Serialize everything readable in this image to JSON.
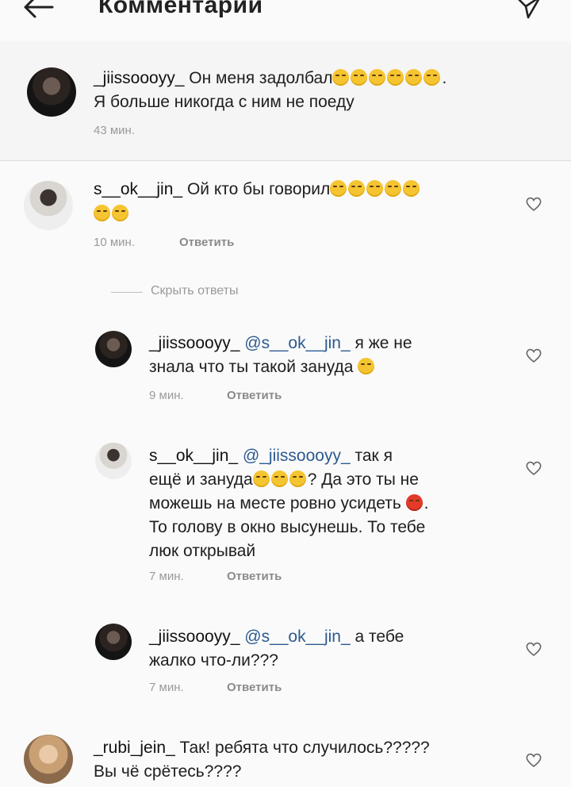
{
  "header": {
    "title": "Комментарии"
  },
  "original_post": {
    "username": "_jiissoooyy_",
    "text_1": "Он меня задолбал",
    "text_1_suffix": ".",
    "text_2": "Я больше никогда с ним не поеду",
    "time": "43 мин."
  },
  "comment_1": {
    "username": "s__ok__jin_",
    "text": "Ой кто бы говорил",
    "time": "10 мин.",
    "reply_label": "Ответить"
  },
  "hide_replies": "Скрыть ответы",
  "reply_1": {
    "username": "_jiissoooyy_",
    "mention": "@s__ok__jin_",
    "line1_text": "я же не",
    "line2_text": "знала что ты такой зануда",
    "time": "9 мин.",
    "reply_label": "Ответить"
  },
  "reply_2": {
    "username": "s__ok__jin_",
    "mention": "@_jiissoooyy_",
    "line1_text": "так я",
    "line2_text": "ещё и зануда",
    "line2_suffix": "? Да это ты не",
    "line3_text": "можешь на месте ровно усидеть",
    "line3_suffix": ".",
    "line4_text": "То голову в окно высунешь. То тебе",
    "line5_text": "люк открывай",
    "time": "7 мин.",
    "reply_label": "Ответить"
  },
  "reply_3": {
    "username": "_jiissoooyy_",
    "mention": "@s__ok__jin_",
    "line1_text": "а тебе",
    "line2_text": "жалко что-ли???",
    "time": "7 мин.",
    "reply_label": "Ответить"
  },
  "comment_2": {
    "username": "_rubi_jein_",
    "line1_text": "Так! ребята что случилось?????",
    "line2_text": "Вы чё срётесь????"
  },
  "icons": {
    "back": "arrow-left-icon",
    "send": "paper-plane-icon",
    "like": "heart-outline-icon",
    "emoji_tired": "tired-face-emoji",
    "emoji_expressionless": "expressionless-face-emoji",
    "emoji_unamused": "unamused-face-emoji",
    "emoji_frowning": "frowning-face-emoji",
    "emoji_angry": "angry-face-emoji"
  },
  "colors": {
    "mention": "#2c5a8f",
    "meta": "#9a9a9a",
    "background": "#fafafa"
  }
}
